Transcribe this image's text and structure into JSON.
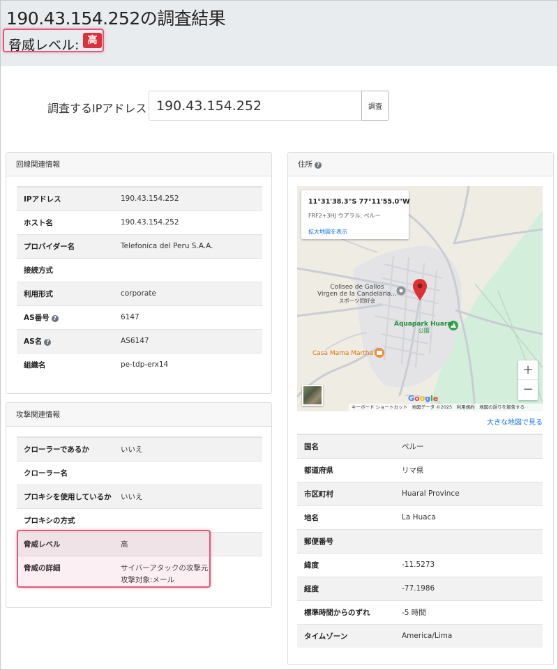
{
  "page": {
    "title": "190.43.154.252の調査結果",
    "threat_label": "脅威レベル:",
    "threat_value": "高"
  },
  "form": {
    "label": "調査するIPアドレス",
    "value": "190.43.154.252",
    "button": "調査"
  },
  "line_info": {
    "title": "回線関連情報",
    "rows": [
      {
        "key": "IPアドレス",
        "value": "190.43.154.252"
      },
      {
        "key": "ホスト名",
        "value": "190.43.154.252"
      },
      {
        "key": "プロバイダー名",
        "value": "Telefonica del Peru S.A.A."
      },
      {
        "key": "接続方式",
        "value": ""
      },
      {
        "key": "利用形式",
        "value": "corporate"
      },
      {
        "key": "AS番号",
        "value": "6147",
        "help": "?"
      },
      {
        "key": "AS名",
        "value": "AS6147",
        "help": "?"
      },
      {
        "key": "組織名",
        "value": "pe-tdp-erx14"
      }
    ]
  },
  "attack_info": {
    "title": "攻撃関連情報",
    "rows": [
      {
        "key": "クローラーであるか",
        "value": "いいえ"
      },
      {
        "key": "クローラー名",
        "value": ""
      },
      {
        "key": "プロキシを使用しているか",
        "value": "いいえ"
      },
      {
        "key": "プロキシの方式",
        "value": ""
      },
      {
        "key": "脅威レベル",
        "value": "高"
      },
      {
        "key": "脅威の詳細",
        "value_lines": [
          "サイバーアタックの攻撃元",
          "攻撃対象:メール"
        ]
      }
    ]
  },
  "address": {
    "title": "住所",
    "help": "?",
    "map": {
      "coords": "11°31'38.3\"S 77°11'55.0\"W",
      "plus_code": "FRF2+3HJ ウアラル, ペルー",
      "enlarge_link": "拡大地図を表示",
      "labels": {
        "coliseo_1": "Coliseo de Gallos",
        "coliseo_2": "Virgen de la Candelaria...",
        "coliseo_3": "スポーツ同好会",
        "aquapark": "Aquapark Huaral",
        "aquapark_sub": "公園",
        "casa": "Casa Mama Martha"
      },
      "zoom_in": "+",
      "zoom_out": "−",
      "google": [
        "G",
        "o",
        "o",
        "g",
        "l",
        "e"
      ],
      "footer": "キーボード ショートカット　地図データ ©2025　利用規約　地図の誤りを報告する",
      "big_map_link": "大きな地図で見る"
    },
    "rows": [
      {
        "key": "国名",
        "value": "ペルー"
      },
      {
        "key": "都道府県",
        "value": "リマ県"
      },
      {
        "key": "市区町村",
        "value": "Huaral Province"
      },
      {
        "key": "地名",
        "value": "La Huaca"
      },
      {
        "key": "郵便番号",
        "value": ""
      },
      {
        "key": "緯度",
        "value": "-11.5273"
      },
      {
        "key": "経度",
        "value": "-77.1986"
      },
      {
        "key": "標準時間からのずれ",
        "value": "-5 時間"
      },
      {
        "key": "タイムゾーン",
        "value": "America/Lima"
      }
    ]
  },
  "colors": {
    "header_bg": "#e9ecef",
    "threat_badge": "#d9323a",
    "highlight_border": "#e0557d",
    "link": "#1a73e8",
    "map_pin": "#db3236",
    "park_green": "#d4eedc"
  }
}
